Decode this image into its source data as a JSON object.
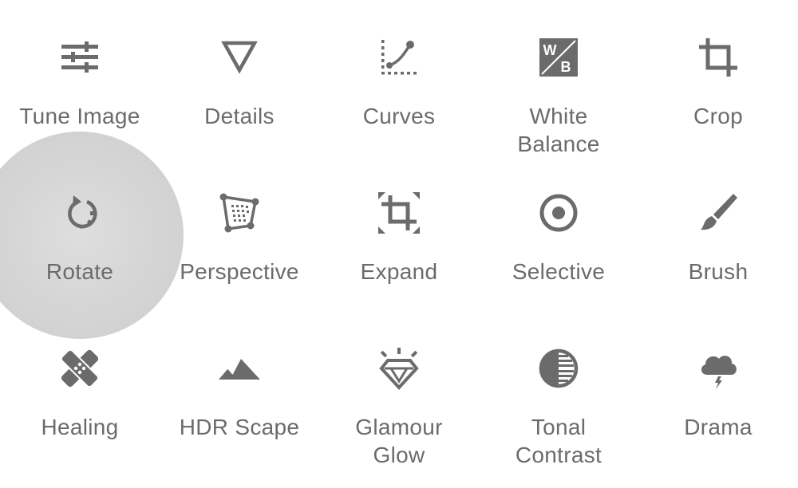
{
  "tools": [
    {
      "label": "Tune Image",
      "icon": "tune-image-icon"
    },
    {
      "label": "Details",
      "icon": "details-icon"
    },
    {
      "label": "Curves",
      "icon": "curves-icon"
    },
    {
      "label": "White\nBalance",
      "icon": "white-balance-icon"
    },
    {
      "label": "Crop",
      "icon": "crop-icon"
    },
    {
      "label": "Rotate",
      "icon": "rotate-icon"
    },
    {
      "label": "Perspective",
      "icon": "perspective-icon"
    },
    {
      "label": "Expand",
      "icon": "expand-icon"
    },
    {
      "label": "Selective",
      "icon": "selective-icon"
    },
    {
      "label": "Brush",
      "icon": "brush-icon"
    },
    {
      "label": "Healing",
      "icon": "healing-icon"
    },
    {
      "label": "HDR Scape",
      "icon": "hdr-scape-icon"
    },
    {
      "label": "Glamour\nGlow",
      "icon": "glamour-glow-icon"
    },
    {
      "label": "Tonal\nContrast",
      "icon": "tonal-contrast-icon"
    },
    {
      "label": "Drama",
      "icon": "drama-icon"
    }
  ],
  "white_balance_badge": {
    "w": "W",
    "b": "B"
  },
  "pressed_tool": "Rotate",
  "colors": {
    "icon": "#6b6b6b",
    "label": "#6b6b6b",
    "ripple": "#d4d4d4",
    "background": "#ffffff"
  }
}
